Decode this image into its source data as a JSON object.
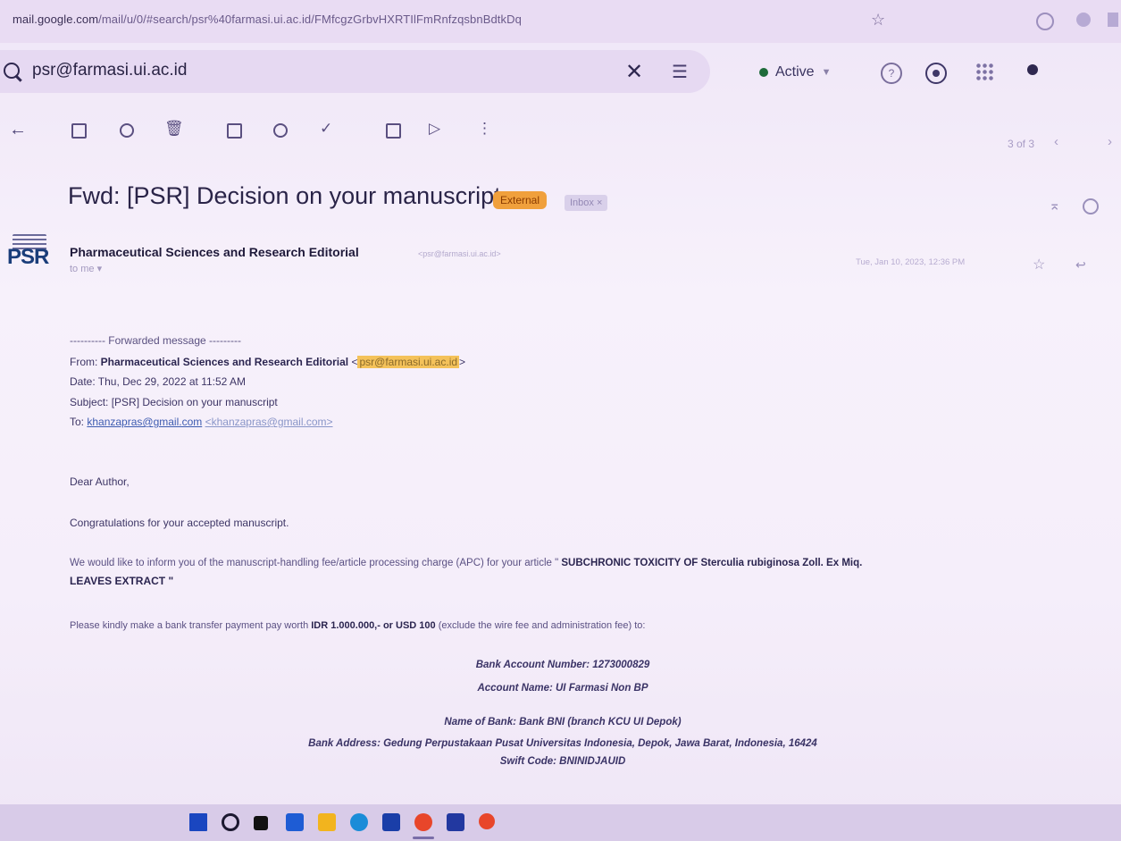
{
  "browser": {
    "url_host": "mail.google.com",
    "url_path": "/mail/u/0/#search/psr%40farmasi.ui.ac.id/FMfcgzGrbvHXRTIlFmRnfzqsbnBdtkDq"
  },
  "search": {
    "query": "psr@farmasi.ui.ac.id",
    "status_label": "Active"
  },
  "toolbar": {
    "page_count": "3 of 3"
  },
  "email": {
    "subject": "Fwd: [PSR] Decision on your manuscript",
    "badge_external": "External",
    "badge_inbox": "Inbox ×",
    "sender_name": "Pharmaceutical Sciences and Research Editorial",
    "sender_email": "<psr@farmasi.ui.ac.id>",
    "to_label": "to me ▾",
    "date": "Tue, Jan 10, 2023, 12:36 PM",
    "avatar_text": "PSR"
  },
  "forwarded": {
    "header": "---------- Forwarded message ---------",
    "from_label": "From: ",
    "from_name": "Pharmaceutical Sciences and Research Editorial",
    "from_email": "psr@farmasi.ui.ac.id",
    "date_line": "Date: Thu, Dec 29, 2022 at 11:52 AM",
    "subject_line": "Subject: [PSR] Decision on your manuscript",
    "to_label": "To: ",
    "to_email": "khanzapras@gmail.com",
    "to_email_bracket": "<khanzapras@gmail.com>"
  },
  "body": {
    "greeting": "Dear Author,",
    "congrats": "Congratulations for your accepted manuscript.",
    "inform_prefix": "We would like to inform you of the manuscript-handling fee/article processing charge (APC) for your article \"",
    "article_title_1": " SUBCHRONIC TOXICITY OF Sterculia rubiginosa Zoll. Ex Miq.",
    "article_title_2": "LEAVES EXTRACT \"",
    "payment_prefix": "Please kindly make a bank transfer payment pay worth ",
    "payment_amount": "IDR 1.000.000,- or USD 100",
    "payment_suffix": " (exclude the wire fee and administration fee) to:",
    "account_number": "Bank Account Number: 1273000829",
    "account_name": "Account Name: UI Farmasi Non BP",
    "bank_name": "Name of Bank: Bank BNI (branch KCU UI Depok)",
    "bank_address": "Bank Address: Gedung Perpustakaan Pusat Universitas Indonesia, Depok, Jawa Barat, Indonesia, 16424",
    "swift_code": "Swift Code: BNINIDJAUID"
  }
}
